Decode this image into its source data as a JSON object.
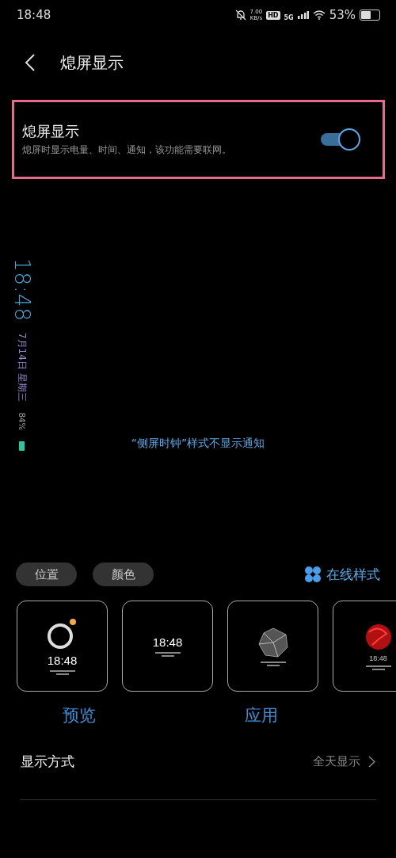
{
  "status_bar": {
    "time": "18:48",
    "speed": "7.00",
    "speed_unit": "KB/s",
    "hd": "HD",
    "network": "5G",
    "battery": "53%"
  },
  "header": {
    "title": "熄屏显示"
  },
  "setting": {
    "title": "熄屏显示",
    "subtitle": "熄屏时显示电量、时间、通知，该功能需要联网。",
    "on": true,
    "highlighted": true
  },
  "preview": {
    "time": "18:48",
    "date": "7月14日 星期三",
    "battery": "84%",
    "notice": "“侧屏时钟”样式不显示通知"
  },
  "chips": [
    {
      "label": "位置"
    },
    {
      "label": "颜色"
    }
  ],
  "online_styles": {
    "label": "在线样式"
  },
  "styles": [
    {
      "kind": "ring",
      "time": "18:48"
    },
    {
      "kind": "digital",
      "time": "18:48"
    },
    {
      "kind": "crystal"
    },
    {
      "kind": "flower",
      "time": "18:48"
    }
  ],
  "actions": [
    {
      "label": "预览"
    },
    {
      "label": "应用"
    }
  ],
  "rows": [
    {
      "label": "显示方式",
      "value": "全天显示"
    }
  ]
}
